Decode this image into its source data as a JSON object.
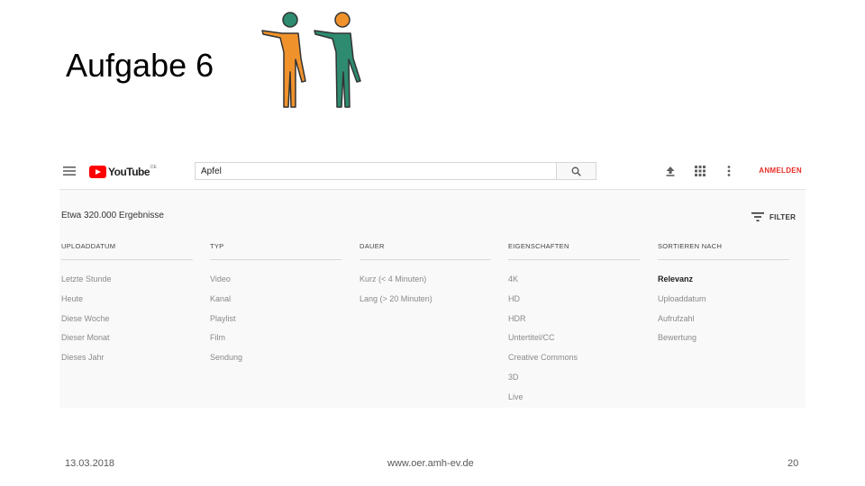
{
  "slide": {
    "title": "Aufgabe 6",
    "footer_date": "13.03.2018",
    "footer_url": "www.oer.amh-ev.de",
    "page_number": "20"
  },
  "youtube": {
    "logo_text": "YouTube",
    "logo_region": "DE",
    "search_value": "Apfel",
    "sign_in_label": "ANMELDEN",
    "results_count": "Etwa 320.000 Ergebnisse",
    "filter_label": "FILTER",
    "accent_color": "#e52d27",
    "icons": [
      "menu-icon",
      "search-icon",
      "upload-icon",
      "apps-grid-icon",
      "more-vert-icon",
      "filter-icon"
    ],
    "columns": [
      {
        "header": "UPLOADDATUM",
        "items": [
          "Letzte Stunde",
          "Heute",
          "Diese Woche",
          "Dieser Monat",
          "Dieses Jahr"
        ]
      },
      {
        "header": "TYP",
        "items": [
          "Video",
          "Kanal",
          "Playlist",
          "Film",
          "Sendung"
        ]
      },
      {
        "header": "DAUER",
        "items": [
          "Kurz (< 4 Minuten)",
          "Lang (> 20 Minuten)"
        ]
      },
      {
        "header": "EIGENSCHAFTEN",
        "items": [
          "4K",
          "HD",
          "HDR",
          "Untertitel/CC",
          "Creative Commons",
          "3D",
          "Live"
        ]
      },
      {
        "header": "SORTIEREN NACH",
        "items": [
          "Relevanz",
          "Uploaddatum",
          "Aufrufzahl",
          "Bewertung"
        ],
        "active": "Relevanz"
      }
    ]
  },
  "illustration": {
    "figure_left_color": "#f0922c",
    "figure_right_color": "#2e8b6f"
  }
}
